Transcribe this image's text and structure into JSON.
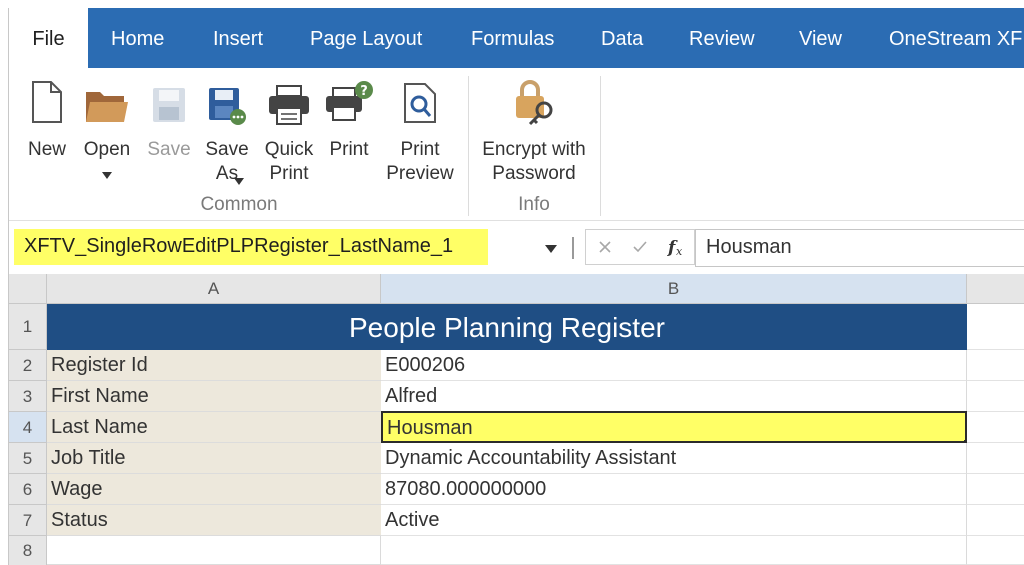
{
  "tabs": [
    "File",
    "Home",
    "Insert",
    "Page Layout",
    "Formulas",
    "Data",
    "Review",
    "View",
    "OneStream XF"
  ],
  "ribbon": {
    "common_group": "Common",
    "info_group": "Info",
    "new": "New",
    "open": "Open",
    "save": "Save",
    "save_as": "Save\nAs",
    "quick_print": "Quick\nPrint",
    "print": "Print",
    "print_preview": "Print\nPreview",
    "encrypt": "Encrypt with\nPassword"
  },
  "formula_bar": {
    "name_box": "XFTV_SingleRowEditPLPRegister_LastName_1",
    "value": "Housman"
  },
  "grid": {
    "columns": [
      "A",
      "B"
    ],
    "rows": [
      "1",
      "2",
      "3",
      "4",
      "5",
      "6",
      "7",
      "8"
    ],
    "title": "People Planning Register",
    "records": [
      {
        "label": "Register Id",
        "value": "E000206"
      },
      {
        "label": "First Name",
        "value": "Alfred"
      },
      {
        "label": "Last Name",
        "value": "Housman"
      },
      {
        "label": "Job Title",
        "value": "Dynamic Accountability Assistant"
      },
      {
        "label": "Wage",
        "value": "87080.000000000"
      },
      {
        "label": "Status",
        "value": "Active"
      }
    ]
  },
  "colors": {
    "tab_bar": "#2b6cb3",
    "title_fill": "#1f4e84",
    "highlight": "#ffff66",
    "label_fill": "#ede8dc"
  }
}
